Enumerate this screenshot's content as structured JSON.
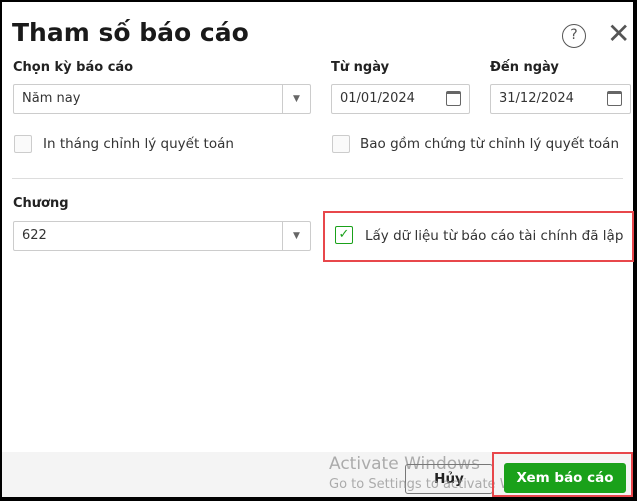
{
  "dialog": {
    "title": "Tham số báo cáo"
  },
  "period": {
    "label": "Chọn kỳ báo cáo",
    "value": "Năm nay"
  },
  "from": {
    "label": "Từ ngày",
    "value": "01/01/2024"
  },
  "to": {
    "label": "Đến ngày",
    "value": "31/12/2024"
  },
  "checkboxes": {
    "print_adjust": {
      "label": "In tháng chỉnh lý quyết toán",
      "checked": false
    },
    "include_adjust": {
      "label": "Bao gồm chứng từ chỉnh lý quyết toán",
      "checked": false
    },
    "use_fs": {
      "label": "Lấy dữ liệu từ báo cáo tài chính đã lập",
      "checked": true
    }
  },
  "chapter": {
    "label": "Chương",
    "value": "622"
  },
  "footer": {
    "cancel": "Hủy",
    "submit": "Xem báo cáo"
  },
  "watermark": {
    "line1": "Activate Windows",
    "line2": "Go to Settings to activate Windows."
  },
  "colors": {
    "accent": "#1aa11a",
    "highlight": "#e8474b"
  }
}
